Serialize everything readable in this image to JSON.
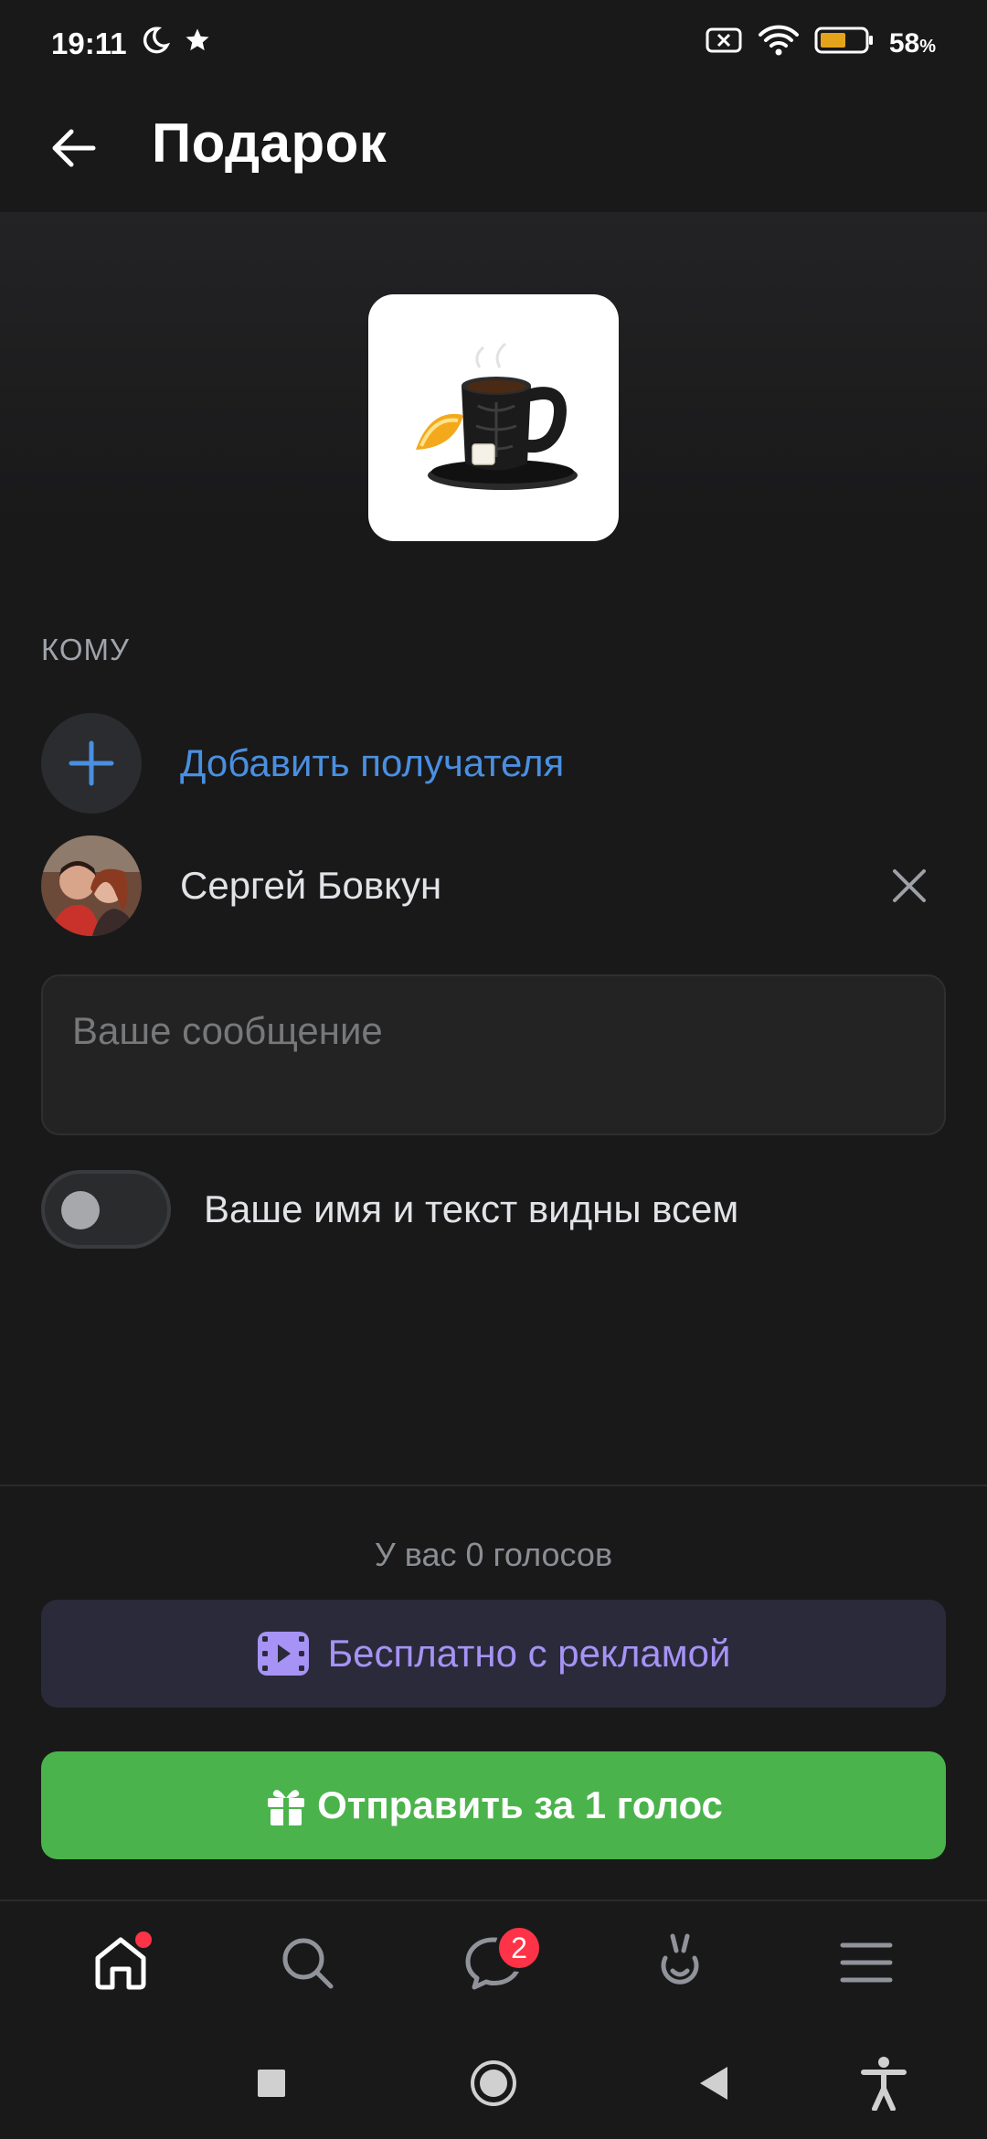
{
  "status_bar": {
    "time": "19:11",
    "battery_percent": "58",
    "battery_unit": "%",
    "icons": [
      "moon-icon",
      "star-icon",
      "no-sim-icon",
      "wifi-icon",
      "battery-icon"
    ],
    "battery_color": "#e5a31c"
  },
  "header": {
    "title": "Подарок",
    "back_icon": "arrow-left-icon"
  },
  "gift": {
    "image": "muscle-mug-tea-lemon"
  },
  "recipients": {
    "section_label": "КОМУ",
    "add_label": "Добавить получателя",
    "items": [
      {
        "name": "Сергей Бовкун"
      }
    ]
  },
  "message": {
    "placeholder": "Ваше сообщение",
    "value": ""
  },
  "visibility_toggle": {
    "label": "Ваше имя и текст видны всем",
    "enabled": false
  },
  "footer": {
    "votes_text": "У вас 0 голосов",
    "ad_button_label": "Бесплатно с рекламой",
    "send_button_label": "Отправить за 1 голос"
  },
  "tab_bar": {
    "tabs": [
      {
        "icon": "home-icon",
        "active": true,
        "dot": true
      },
      {
        "icon": "search-icon",
        "active": false
      },
      {
        "icon": "messages-icon",
        "active": false,
        "badge": "2"
      },
      {
        "icon": "clips-icon",
        "active": false
      },
      {
        "icon": "menu-icon",
        "active": false
      }
    ]
  },
  "colors": {
    "accent_blue": "#4a8fe0",
    "ad_purple": "#a693f5",
    "send_green": "#4bb34b",
    "badge_red": "#ff3347"
  }
}
